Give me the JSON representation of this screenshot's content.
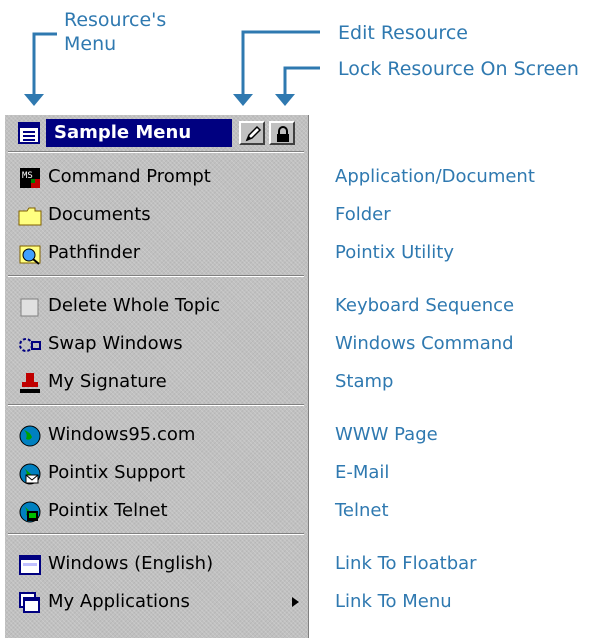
{
  "callouts": {
    "resource_menu": "Resource's\nMenu",
    "edit_resource": "Edit Resource",
    "lock_resource": "Lock Resource On Screen"
  },
  "menu": {
    "title": "Sample Menu",
    "groups": [
      [
        {
          "label": "Command Prompt",
          "description": "Application/Document",
          "icon": "command-prompt-icon"
        },
        {
          "label": "Documents",
          "description": "Folder",
          "icon": "folder-icon"
        },
        {
          "label": "Pathfinder",
          "description": "Pointix Utility",
          "icon": "pathfinder-icon"
        }
      ],
      [
        {
          "label": "Delete Whole Topic",
          "description": "Keyboard Sequence",
          "icon": "keyboard-sequence-icon"
        },
        {
          "label": "Swap Windows",
          "description": "Windows Command",
          "icon": "swap-windows-icon"
        },
        {
          "label": "My Signature",
          "description": "Stamp",
          "icon": "stamp-icon"
        }
      ],
      [
        {
          "label": "Windows95.com",
          "description": "WWW Page",
          "icon": "globe-web-icon"
        },
        {
          "label": "Pointix Support",
          "description": "E-Mail",
          "icon": "globe-email-icon"
        },
        {
          "label": "Pointix Telnet",
          "description": "Telnet",
          "icon": "globe-telnet-icon"
        }
      ],
      [
        {
          "label": "Windows (English)",
          "description": "Link To Floatbar",
          "icon": "floatbar-icon"
        },
        {
          "label": "My Applications",
          "description": "Link To Menu",
          "icon": "applications-menu-icon",
          "submenu": true
        }
      ]
    ]
  },
  "colors": {
    "callout_text": "#2f79b0",
    "title_bar": "#000080",
    "menu_background": "#c0c0c0"
  }
}
